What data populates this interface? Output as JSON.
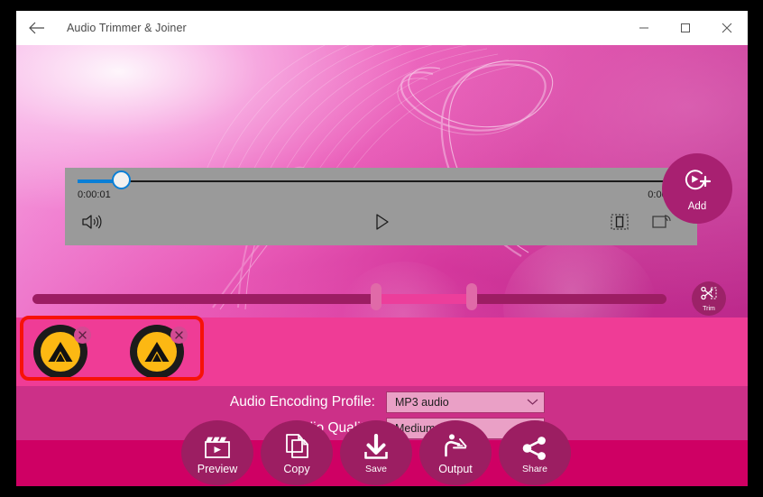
{
  "window": {
    "title": "Audio Trimmer & Joiner",
    "back_icon": "back-arrow-icon",
    "minimize_label": "—",
    "maximize_label": "□",
    "close_label": "✕"
  },
  "player": {
    "current_time": "0:00:01",
    "total_time": "0:00:05",
    "volume_icon": "volume-icon",
    "play_icon": "play-icon",
    "aspect_icon": "aspect-ratio-icon",
    "cast_icon": "cast-icon",
    "progress_percent": 7
  },
  "add_button": {
    "label": "Add",
    "icon": "add-media-icon",
    "color": "#a82071"
  },
  "timeline": {
    "trim_button_label": "Trim",
    "trim_button_icon": "scissors-icon",
    "selection_start_percent": 54,
    "selection_end_percent": 69,
    "track_color": "#9c1d63",
    "selection_color": "#ec3e9b"
  },
  "clips": {
    "items": [
      {
        "name": "audio-clip-1",
        "remove_label": "✕"
      },
      {
        "name": "audio-clip-2",
        "remove_label": "✕"
      }
    ],
    "strip_color": "#ef3c96",
    "annotation_color": "#f71208"
  },
  "settings": {
    "rows": [
      {
        "label": "Audio Encoding Profile:",
        "value": "MP3 audio",
        "chevron": "chevron-down-icon"
      },
      {
        "label": "Audio Quality:",
        "value": "Medium",
        "chevron": "chevron-down-icon"
      }
    ]
  },
  "toolbar": {
    "buttons": [
      {
        "label": "Preview",
        "icon": "clapperboard-icon"
      },
      {
        "label": "Copy",
        "icon": "copy-pages-icon"
      },
      {
        "label": "Save",
        "icon": "download-icon"
      },
      {
        "label": "Output",
        "icon": "person-at-desk-icon"
      },
      {
        "label": "Share",
        "icon": "share-nodes-icon"
      }
    ],
    "background": "#cf0064",
    "button_color": "#9c1e62"
  }
}
